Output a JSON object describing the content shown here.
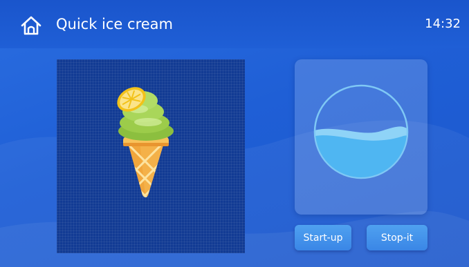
{
  "header": {
    "title": "Quick ice cream",
    "time": "14:32",
    "home_icon": "home-icon"
  },
  "product": {
    "icon": "ice-cream-cone-icon"
  },
  "status": {
    "fill_level": 0.48,
    "icon": "level-gauge"
  },
  "controls": {
    "start_label": "Start-up",
    "stop_label": "Stop-it"
  },
  "colors": {
    "background": "#1f5fd6",
    "panel": "#123b94",
    "liquid": "#4fb6f2",
    "button": "#4a97ee"
  }
}
